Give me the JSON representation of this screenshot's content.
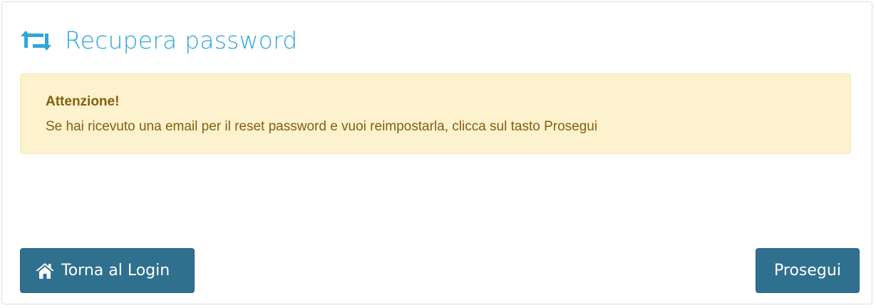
{
  "page": {
    "title": "Recupera password",
    "title_icon": "retweet-icon",
    "accent_color": "#2ea7d9"
  },
  "alert": {
    "title": "Attenzione!",
    "message": "Se hai ricevuto una email per il reset password e vuoi reimpostarla, clicca sul tasto Prosegui",
    "background_color": "#fdf2ce",
    "text_color": "#855e10"
  },
  "actions": {
    "back_label": "Torna al Login",
    "back_icon": "home-icon",
    "next_label": "Prosegui",
    "button_color": "#30708f"
  }
}
